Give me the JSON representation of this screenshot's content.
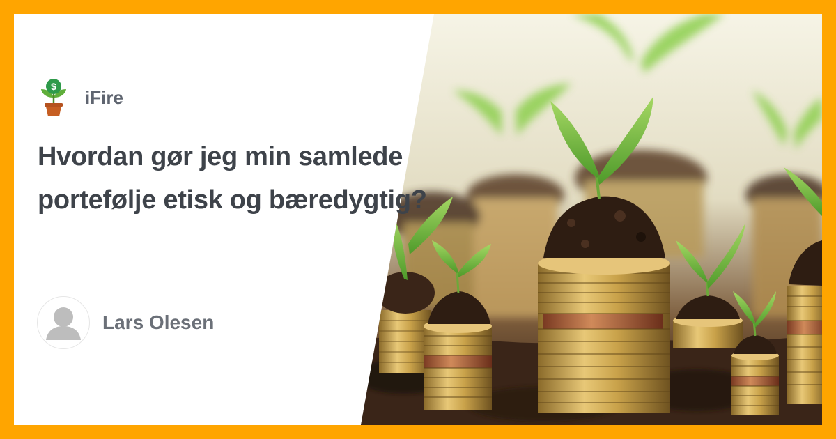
{
  "brand": {
    "name": "iFire",
    "logo_icon": "money-plant-icon"
  },
  "article": {
    "title": "Hvordan gør jeg min samlede portefølje etisk og bæredygtig?"
  },
  "author": {
    "name": "Lars Olesen",
    "avatar_icon": "user-silhouette-icon"
  },
  "colors": {
    "frame": "#ffa500",
    "title": "#3e434a",
    "muted": "#6b7078",
    "coin": "#c9a24a",
    "soil": "#3a2518",
    "sprout": "#7cc242"
  }
}
